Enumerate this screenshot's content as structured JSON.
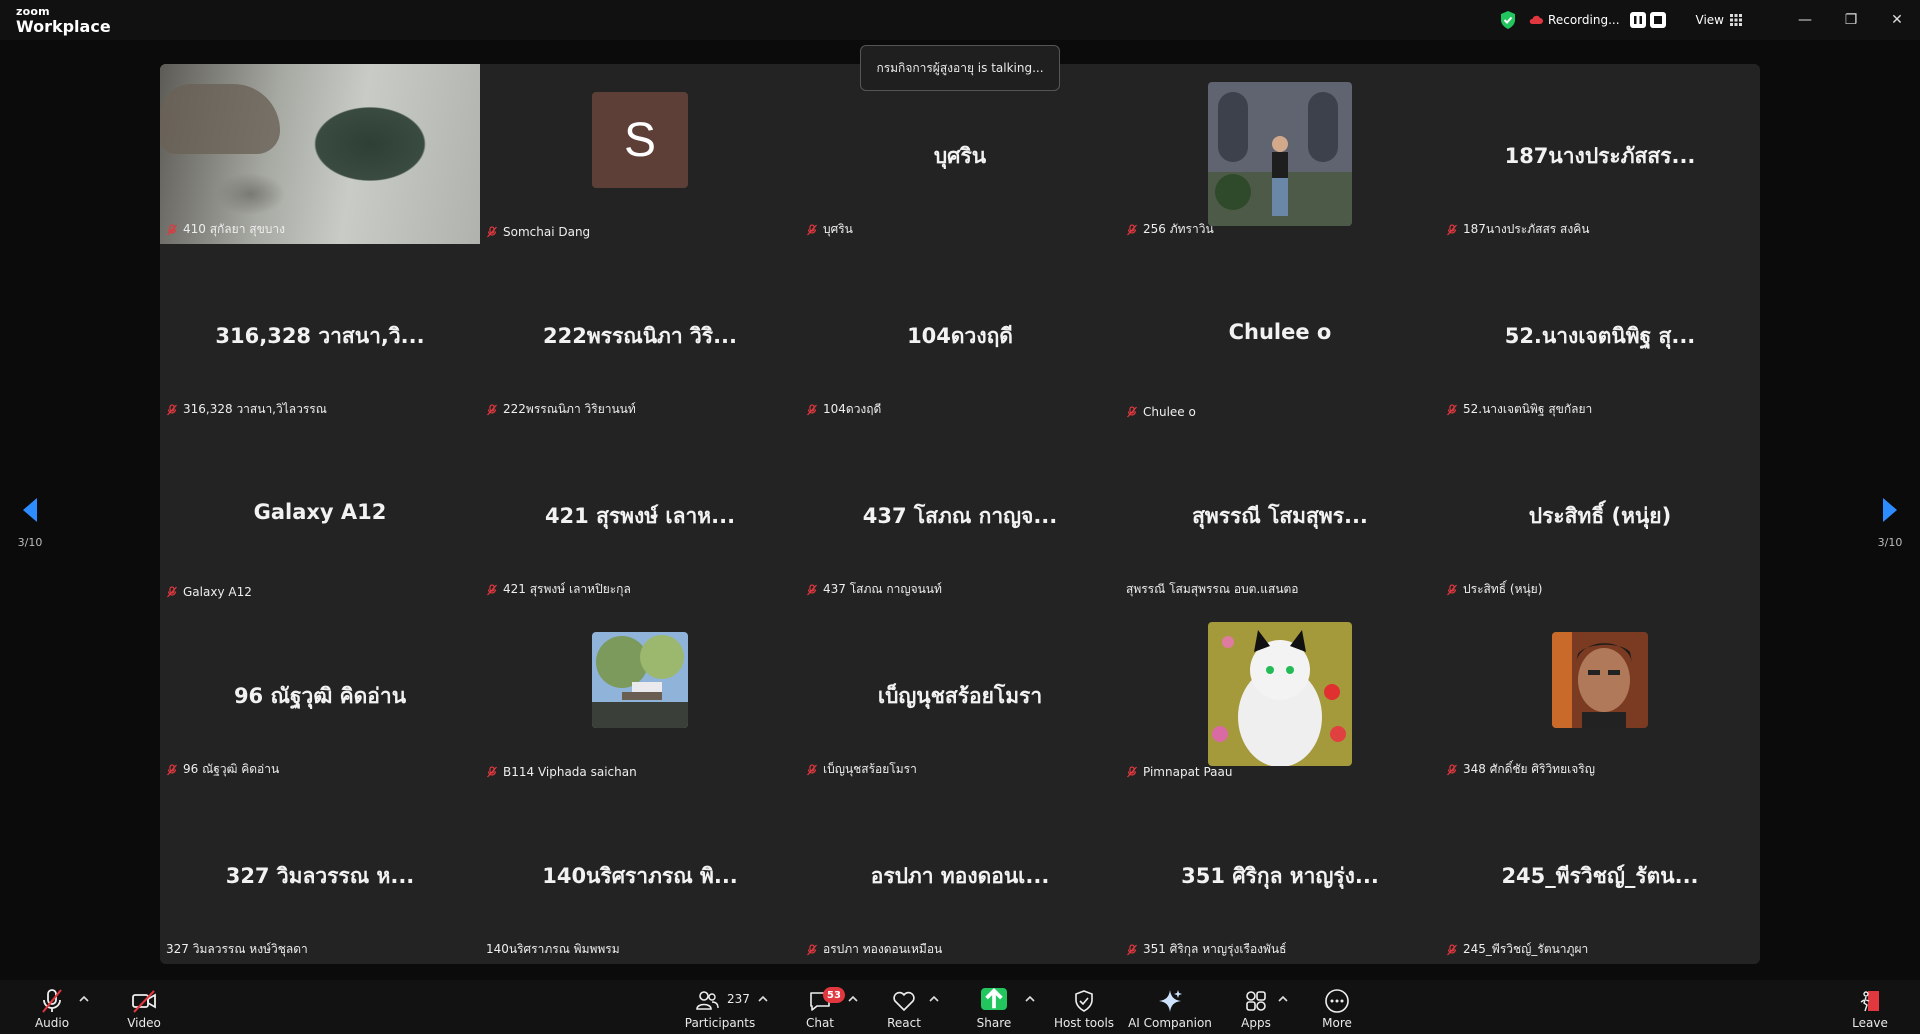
{
  "app": {
    "brand_small": "zoom",
    "brand_big": "Workplace"
  },
  "titlebar": {
    "recording_label": "Recording...",
    "view_label": "View",
    "minimize": "—",
    "restore": "❐",
    "close": "✕"
  },
  "talking_indicator": "กรมกิจการผู้สูงอายุ is talking...",
  "pagination": {
    "left": "3/10",
    "right": "3/10"
  },
  "tiles": [
    {
      "kind": "video",
      "label": "410 สุกัลยา สุขบาง",
      "muted": true
    },
    {
      "kind": "letter",
      "letter": "S",
      "label": "Somchai Dang",
      "muted": true
    },
    {
      "kind": "name",
      "display": "บุศริน",
      "label": "บุศริน",
      "muted": true
    },
    {
      "kind": "photo",
      "photo": "woman-photo",
      "label": "256 ภัทราวิน",
      "muted": true
    },
    {
      "kind": "name",
      "display": "187นางประภัสสร...",
      "label": "187นางประภัสสร สงคิน",
      "muted": true
    },
    {
      "kind": "name",
      "display": "316,328 วาสนา,วิ...",
      "label": "316,328 วาสนา,วิไลวรรณ",
      "muted": true
    },
    {
      "kind": "name",
      "display": "222พรรณนิภา วิริ...",
      "label": "222พรรณนิภา วิริยานนท์",
      "muted": true
    },
    {
      "kind": "name",
      "display": "104ดวงฤดี",
      "label": "104ดวงฤดี",
      "muted": true
    },
    {
      "kind": "name",
      "display": "Chulee o",
      "label": "Chulee o",
      "muted": true
    },
    {
      "kind": "name",
      "display": "52.นางเจตนิพิฐ สุ...",
      "label": "52.นางเจตนิพิฐ สุขกัลยา",
      "muted": true
    },
    {
      "kind": "name",
      "display": "Galaxy A12",
      "label": "Galaxy A12",
      "muted": true
    },
    {
      "kind": "name",
      "display": "421  สุรพงษ์ เลาห...",
      "label": "421  สุรพงษ์ เลาหปิยะกุล",
      "muted": true
    },
    {
      "kind": "name",
      "display": "437  โสภณ กาญจ...",
      "label": "437  โสภณ กาญจนนท์",
      "muted": true
    },
    {
      "kind": "name",
      "display": "สุพรรณี  โสมสุพร...",
      "label": "สุพรรณี  โสมสุพรรณ อบต.แสนตอ",
      "muted": false
    },
    {
      "kind": "name",
      "display": "ประสิทธิ์ (หนุ่ย)",
      "label": "ประสิทธิ์ (หนุ่ย)",
      "muted": true
    },
    {
      "kind": "name",
      "display": "96 ณัฐวุฒิ คิดอ่าน",
      "label": "96 ณัฐวุฒิ คิดอ่าน",
      "muted": true
    },
    {
      "kind": "photo",
      "photo": "outdoor-photo",
      "label": "B114 Viphada saichan",
      "muted": true
    },
    {
      "kind": "name",
      "display": "เบ็ญนุชสร้อยโมรา",
      "label": "เบ็ญนุชสร้อยโมรา",
      "muted": true
    },
    {
      "kind": "photo",
      "photo": "cat-painting",
      "label": "Pimnapat Paau",
      "muted": true
    },
    {
      "kind": "photo",
      "photo": "man-portrait",
      "label": "348 ศักดิ์ชัย ศิริวิทยเจริญ",
      "muted": true
    },
    {
      "kind": "name",
      "display": "327 วิมลวรรณ  ห...",
      "label": "327 วิมลวรรณ  หงษ์วิชุลดา",
      "muted": false
    },
    {
      "kind": "name",
      "display": "140นริศราภรณ พิ...",
      "label": "140นริศราภรณ พิมพพรม",
      "muted": false
    },
    {
      "kind": "name",
      "display": "อรปภา ทองดอนเ...",
      "label": "อรปภา ทองดอนเหมือน",
      "muted": true
    },
    {
      "kind": "name",
      "display": "351 ศิริกุล หาญรุ่ง...",
      "label": "351 ศิริกุล หาญรุ่งเรืองพันธ์",
      "muted": true
    },
    {
      "kind": "name",
      "display": "245_พีรวิชญ์_รัตน...",
      "label": "245_พีรวิชญ์_รัตนาภูผา",
      "muted": true
    }
  ],
  "toolbar": {
    "audio": "Audio",
    "video": "Video",
    "participants": "Participants",
    "participants_count": "237",
    "chat": "Chat",
    "chat_badge": "53",
    "react": "React",
    "share": "Share",
    "host_tools": "Host tools",
    "ai_companion": "AI Companion",
    "apps": "Apps",
    "more": "More",
    "leave": "Leave"
  },
  "colors": {
    "share_green": "#22c55e",
    "badge_red": "#e0383e",
    "nav_blue": "#2d8cff",
    "mute_red": "#e0383e"
  }
}
